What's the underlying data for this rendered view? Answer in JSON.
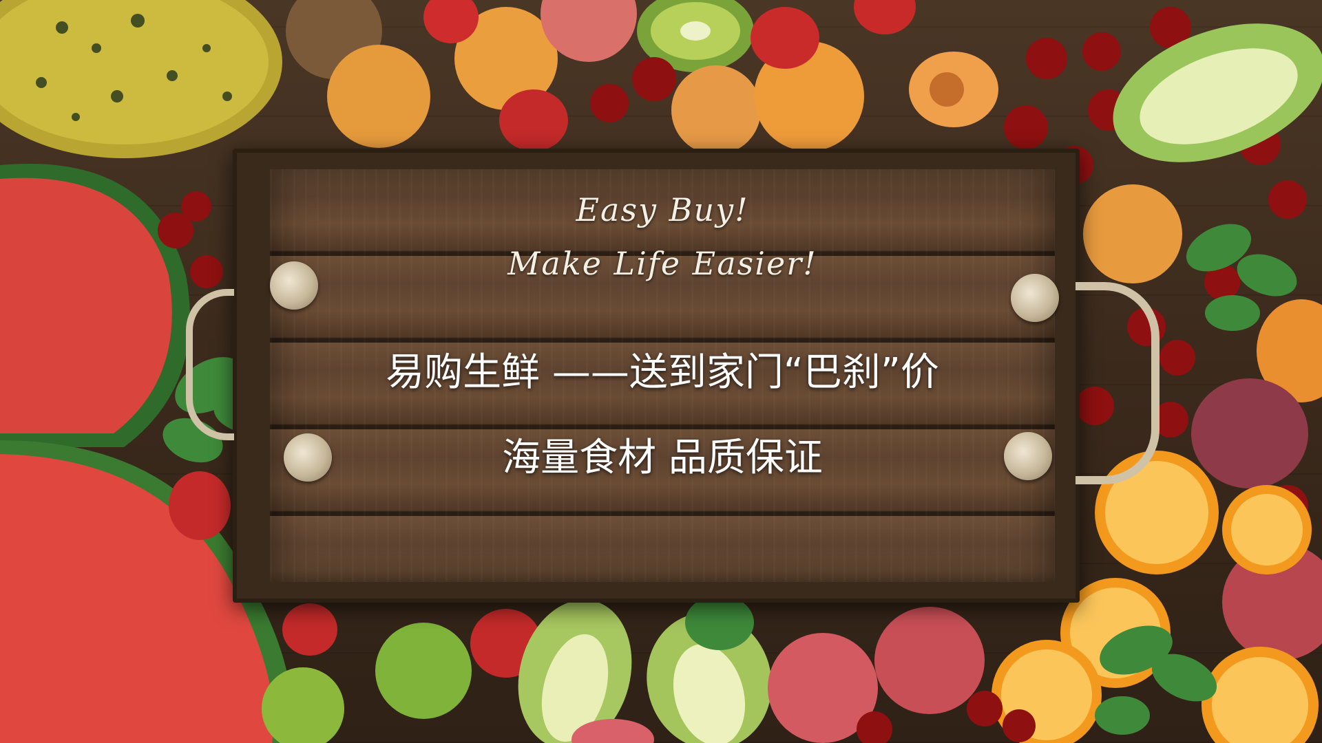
{
  "slide": {
    "slogan_line1": "Easy Buy!",
    "slogan_line2": "Make Life Easier!",
    "headline": "易购生鲜 ——送到家门“巴刹”价",
    "subheadline": "海量食材 品质保证"
  },
  "colors": {
    "wood": "#5e4330",
    "text": "#ffffff"
  }
}
